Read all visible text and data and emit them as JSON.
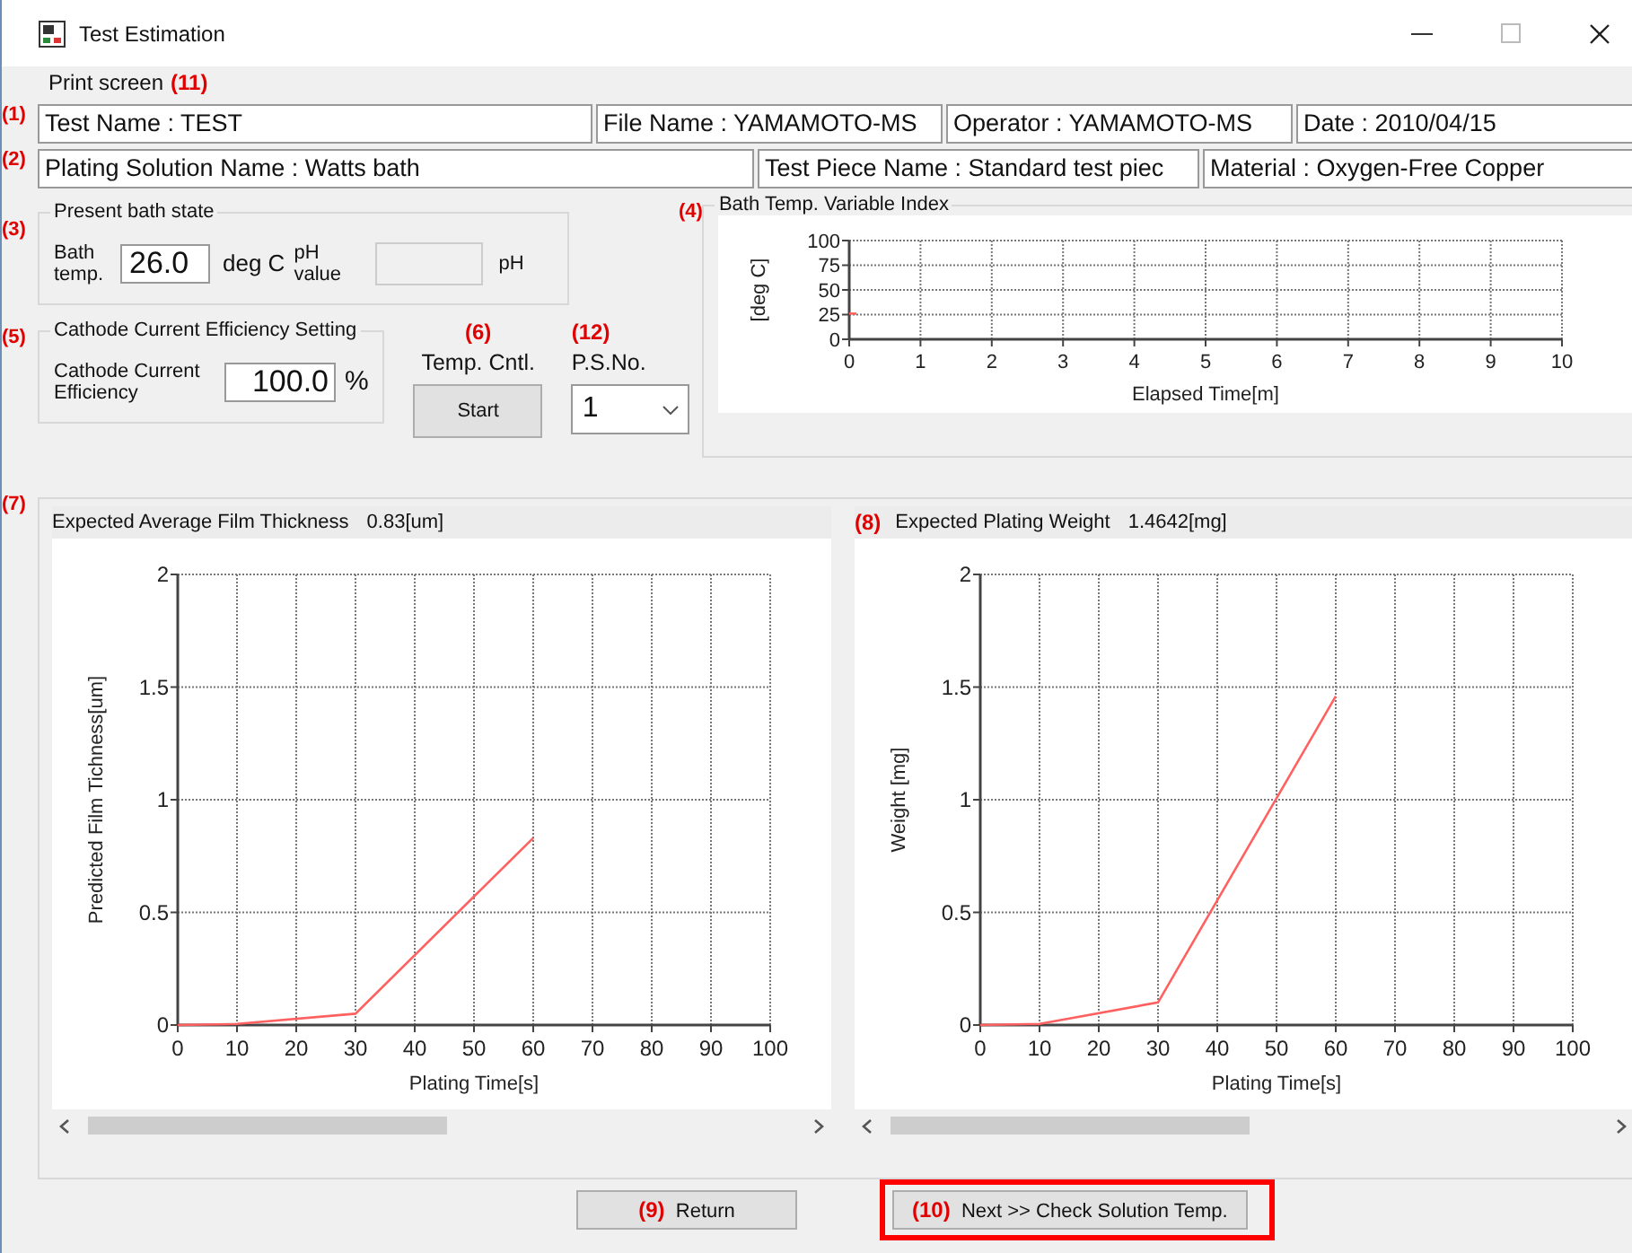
{
  "window": {
    "title": "Test Estimation"
  },
  "menu": [
    {
      "label": "Print screen",
      "marker": "(11)"
    }
  ],
  "info_rows": [
    {
      "marker": "(1)",
      "fields": [
        "Test Name : TEST",
        "File Name : YAMAMOTO-MS",
        "Operator : YAMAMOTO-MS",
        "Date :  2010/04/15"
      ]
    },
    {
      "marker": "(2)",
      "fields": [
        "Plating Solution Name : Watts bath",
        "Test Piece Name : Standard test piec",
        "Material : Oxygen-Free Copper"
      ]
    }
  ],
  "bath_state": {
    "marker": "(3)",
    "title": "Present bath state",
    "temp_label": "Bath temp.",
    "temp_value": "26.0",
    "temp_unit": "deg C",
    "ph_label": "pH value",
    "ph_disabled": true,
    "ph_unit": "pH"
  },
  "efficiency": {
    "marker": "(5)",
    "title": "Cathode Current Efficiency Setting",
    "label": "Cathode Current Efficiency",
    "value": "100.0",
    "unit": "%"
  },
  "temp_control": {
    "marker": "(6)",
    "label": "Temp. Cntl.",
    "button": "Start"
  },
  "ps_no": {
    "marker": "(12)",
    "label": "P.S.No.",
    "value": "1"
  },
  "temp_chart": {
    "marker": "(4)",
    "title": "Bath Temp. Variable Index",
    "chart_data": {
      "type": "line",
      "xlabel": "Elapsed Time[m]",
      "ylabel": "[deg C]",
      "x": [
        0,
        0.1
      ],
      "grid": true,
      "series": [
        {
          "color": "#ff6060",
          "values": [
            26,
            26
          ]
        }
      ],
      "xlim": [
        0,
        10
      ],
      "ylim": [
        0,
        100
      ],
      "xticks": [
        0,
        1,
        2,
        3,
        4,
        5,
        6,
        7,
        8,
        9,
        10
      ],
      "yticks": [
        0,
        25,
        50,
        75,
        100
      ]
    }
  },
  "results": {
    "marker": "(7)",
    "panels": [
      {
        "title": "Expected Average Film Thickness",
        "value": "0.83[um]",
        "chart_data": {
          "type": "line",
          "xlabel": "Plating Time[s]",
          "ylabel": "Predicted Film Tichness[um]",
          "x": [
            0,
            10,
            30,
            60
          ],
          "grid": true,
          "series": [
            {
              "color": "#ff6060",
              "values": [
                0,
                0.005,
                0.05,
                0.83
              ]
            }
          ],
          "xlim": [
            0,
            100
          ],
          "ylim": [
            0,
            2
          ],
          "xticks": [
            0,
            10,
            20,
            30,
            40,
            50,
            60,
            70,
            80,
            90,
            100
          ],
          "yticks": [
            0,
            0.5,
            1,
            1.5,
            2
          ]
        }
      },
      {
        "marker": "(8)",
        "title": "Expected Plating Weight",
        "value": "1.4642[mg]",
        "chart_data": {
          "type": "line",
          "xlabel": "Plating Time[s]",
          "ylabel": "Weight [mg]",
          "x": [
            0,
            10,
            30,
            60
          ],
          "grid": true,
          "series": [
            {
              "color": "#ff6060",
              "values": [
                0,
                0.005,
                0.1,
                1.46
              ]
            }
          ],
          "xlim": [
            0,
            100
          ],
          "ylim": [
            0,
            2
          ],
          "xticks": [
            0,
            10,
            20,
            30,
            40,
            50,
            60,
            70,
            80,
            90,
            100
          ],
          "yticks": [
            0,
            0.5,
            1,
            1.5,
            2
          ]
        }
      }
    ]
  },
  "buttons": [
    {
      "marker": "(9)",
      "label": "Return",
      "highlighted": false
    },
    {
      "marker": "(10)",
      "label": "Next >> Check Solution Temp.",
      "highlighted": true
    }
  ]
}
